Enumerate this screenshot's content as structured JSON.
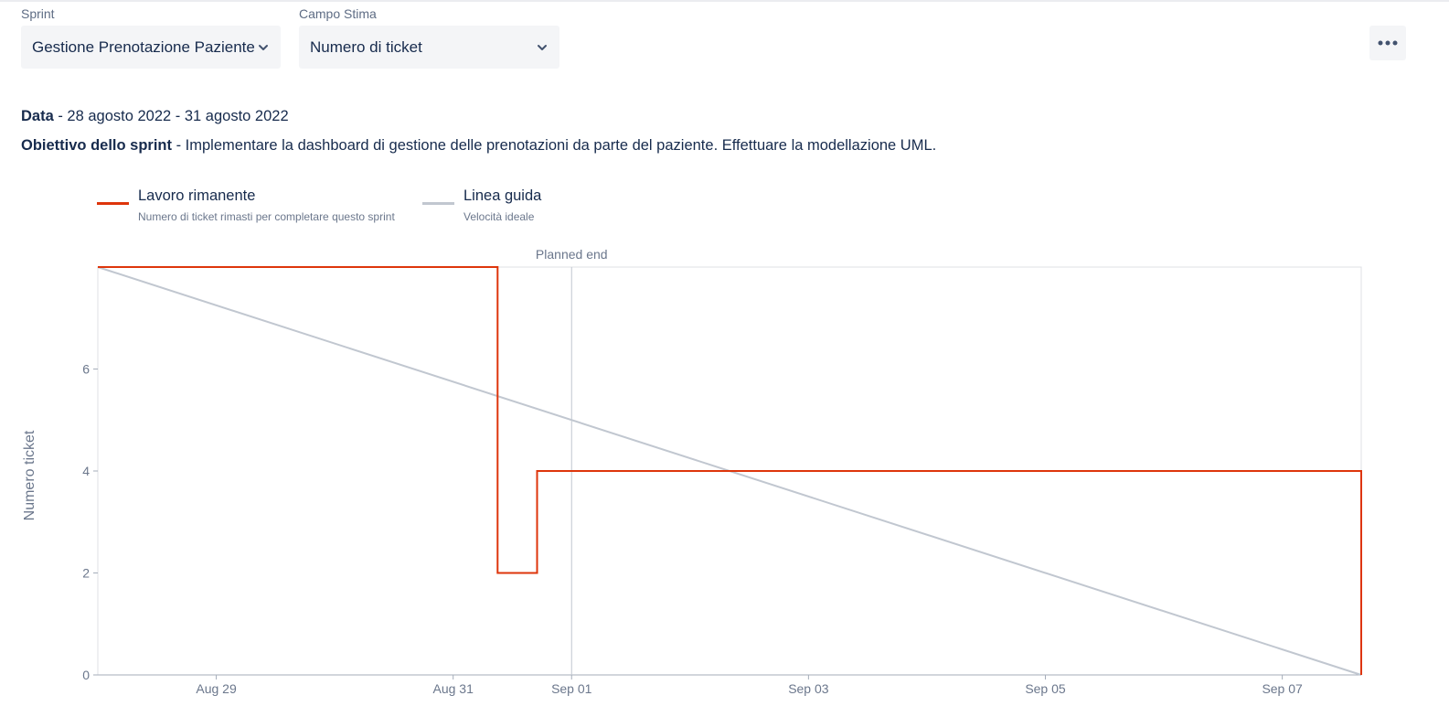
{
  "filters": {
    "sprint": {
      "label": "Sprint",
      "value": "Gestione Prenotazione Paziente"
    },
    "estimate": {
      "label": "Campo Stima",
      "value": "Numero di ticket"
    }
  },
  "more_icon": "more-horizontal-icon",
  "info": {
    "date_label": "Data",
    "date_value": " - 28 agosto 2022 - 31 agosto 2022",
    "goal_label": "Obiettivo dello sprint",
    "goal_value": " - Implementare la dashboard di gestione delle prenotazioni da parte del paziente. Effettuare la modellazione UML."
  },
  "legend": [
    {
      "title": "Lavoro rimanente",
      "subtitle": "Numero di ticket rimasti per completare questo sprint",
      "color": "#de350b"
    },
    {
      "title": "Linea guida",
      "subtitle": "Velocità ideale",
      "color": "#c1c7d0"
    }
  ],
  "chart_data": {
    "type": "line",
    "ylabel": "Numero ticket",
    "ylim": [
      0,
      8
    ],
    "yticks": [
      0,
      2,
      4,
      6
    ],
    "xlim": [
      "2022-08-28",
      "2022-09-07T16:00"
    ],
    "xticks": [
      {
        "date": "2022-08-29",
        "label": "Aug 29"
      },
      {
        "date": "2022-08-31",
        "label": "Aug 31"
      },
      {
        "date": "2022-09-01",
        "label": "Sep 01"
      },
      {
        "date": "2022-09-03",
        "label": "Sep 03"
      },
      {
        "date": "2022-09-05",
        "label": "Sep 05"
      },
      {
        "date": "2022-09-07",
        "label": "Sep 07"
      }
    ],
    "planned_end": {
      "date": "2022-09-01",
      "label": "Planned end"
    },
    "series": [
      {
        "name": "Lavoro rimanente",
        "color": "#de350b",
        "step": true,
        "points": [
          {
            "x": "2022-08-28",
            "y": 8
          },
          {
            "x": "2022-08-31T09:00",
            "y": 8
          },
          {
            "x": "2022-08-31T09:00",
            "y": 2
          },
          {
            "x": "2022-08-31T17:00",
            "y": 2
          },
          {
            "x": "2022-08-31T17:00",
            "y": 4
          },
          {
            "x": "2022-09-07T16:00",
            "y": 4
          },
          {
            "x": "2022-09-07T16:00",
            "y": 0
          }
        ]
      },
      {
        "name": "Linea guida",
        "color": "#c1c7d0",
        "step": false,
        "points": [
          {
            "x": "2022-08-28",
            "y": 8
          },
          {
            "x": "2022-09-07T16:00",
            "y": 0
          }
        ]
      }
    ]
  }
}
